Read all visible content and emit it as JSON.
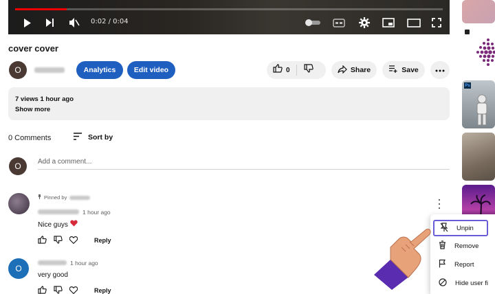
{
  "player": {
    "timecode": "0:02 / 0:04",
    "progress_fraction": 0.12,
    "icons": [
      "play-icon",
      "next-icon",
      "mute-icon",
      "autoplay-toggle-icon",
      "captions-icon",
      "settings-icon",
      "miniplayer-icon",
      "theater-icon",
      "fullscreen-icon"
    ]
  },
  "video": {
    "title": "cover cover",
    "channel_initial": "O"
  },
  "actions": {
    "analytics": "Analytics",
    "edit_video": "Edit video",
    "like_count": "0",
    "share": "Share",
    "save": "Save"
  },
  "description": {
    "stats": "7 views  1 hour ago",
    "show_more": "Show more"
  },
  "comments": {
    "count_label": "0 Comments",
    "sort_label": "Sort by",
    "add_placeholder": "Add a comment...",
    "user_initial": "O",
    "pinned_prefix": "Pinned by",
    "items": [
      {
        "time": "1 hour ago",
        "text": "Nice guys",
        "reply": "Reply",
        "avatar_initial": ""
      },
      {
        "time": "1 hour ago",
        "text": "very good",
        "reply": "Reply",
        "avatar_initial": "O"
      }
    ]
  },
  "menu": {
    "items": [
      "Unpin",
      "Remove",
      "Report",
      "Hide user fi"
    ]
  },
  "colors": {
    "brand_blue": "#1f5fbf",
    "progress_red": "#ee0000",
    "menu_highlight": "#6a5cd6",
    "heart": "#d62a3a"
  }
}
